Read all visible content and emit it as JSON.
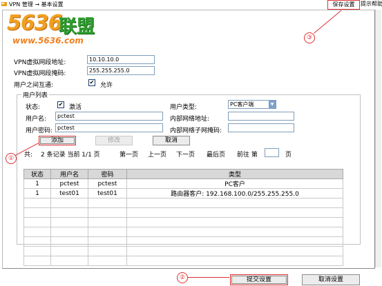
{
  "header": {
    "breadcrumb": "VPN 管理 → 基本设置",
    "save_button": "保存设置",
    "help_button": "提示帮助"
  },
  "logo": {
    "digits": "5636",
    "brand": "联盟",
    "url": "www.5636.com"
  },
  "form": {
    "vpn_addr_label": "VPN虚拟网段地址:",
    "vpn_addr_value": "10.10.10.0",
    "vpn_mask_label": "VPN虚拟网段掩码:",
    "vpn_mask_value": "255.255.255.0",
    "interop_label": "用户之间互通:",
    "interop_checked": true,
    "interop_text": "允许"
  },
  "user_list": {
    "legend": "用户列表",
    "status_label": "状态:",
    "status_checked": true,
    "status_text": "激活",
    "user_type_label": "用户类型:",
    "user_type_value": "PC客户端",
    "username_label": "用户名:",
    "username_value": "pctest",
    "internal_addr_label": "内部网络地址:",
    "internal_addr_value": "",
    "password_label": "用户密码:",
    "password_value": "pctest",
    "internal_mask_label": "内部网络子网掩码:",
    "internal_mask_value": "",
    "add_button": "添加",
    "modify_button": "修改",
    "cancel_button": "取消"
  },
  "pager": {
    "total_label": "共:",
    "summary": "2 条记录 当前 1/1 页",
    "first": "第一页",
    "prev": "上一页",
    "next": "下一页",
    "last": "最后页",
    "goto": "前往 第",
    "goto_suffix": "页",
    "goto_value": ""
  },
  "table": {
    "headers": [
      "状态",
      "用户名",
      "密码",
      "类型"
    ],
    "rows": [
      [
        "1",
        "pctest",
        "pctest",
        "PC客户"
      ],
      [
        "1",
        "test01",
        "test01",
        "路由器客户: 192.168.100.0/255.255.255.0"
      ]
    ],
    "empty_rows": 7
  },
  "footer": {
    "submit_button": "提交设置",
    "cancel_button": "取消设置"
  },
  "annotations": {
    "one": "①",
    "two": "②",
    "three": "③",
    "color": "#e03030"
  },
  "colors": {
    "header_bg": "#d8d8d8",
    "input_border": "#7f9db9",
    "logo_orange": "#f0a020",
    "logo_green": "#30a030"
  }
}
